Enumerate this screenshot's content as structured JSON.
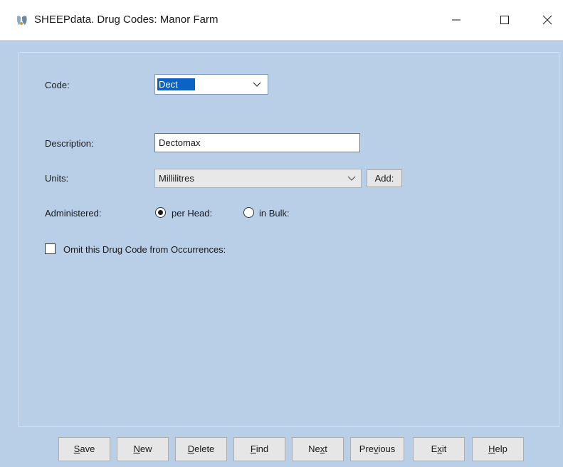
{
  "window": {
    "title": "SHEEPdata. Drug Codes: Manor Farm",
    "controls": [
      "minimize-icon",
      "maximize-icon",
      "close-icon"
    ]
  },
  "form": {
    "code": {
      "label": "Code:",
      "value": "Dect"
    },
    "description": {
      "label": "Description:",
      "value": "Dectomax"
    },
    "units": {
      "label": "Units:",
      "value": "Millilitres",
      "add_label": "Add:"
    },
    "administered": {
      "label": "Administered:",
      "options": [
        {
          "label": "per Head:",
          "selected": true
        },
        {
          "label": "in Bulk:",
          "selected": false
        }
      ]
    },
    "omit": {
      "label": "Omit this Drug Code from Occurrences:",
      "checked": false
    }
  },
  "buttons": [
    {
      "pre": "",
      "key": "S",
      "post": "ave"
    },
    {
      "pre": "",
      "key": "N",
      "post": "ew"
    },
    {
      "pre": "",
      "key": "D",
      "post": "elete"
    },
    {
      "pre": "",
      "key": "F",
      "post": "ind"
    },
    {
      "pre": "Ne",
      "key": "x",
      "post": "t"
    },
    {
      "pre": "Pre",
      "key": "v",
      "post": "ious"
    },
    {
      "pre": "E",
      "key": "x",
      "post": "it"
    },
    {
      "pre": "",
      "key": "H",
      "post": "elp"
    }
  ],
  "colors": {
    "background": "#b9cfe8",
    "selection": "#0a64c8"
  }
}
